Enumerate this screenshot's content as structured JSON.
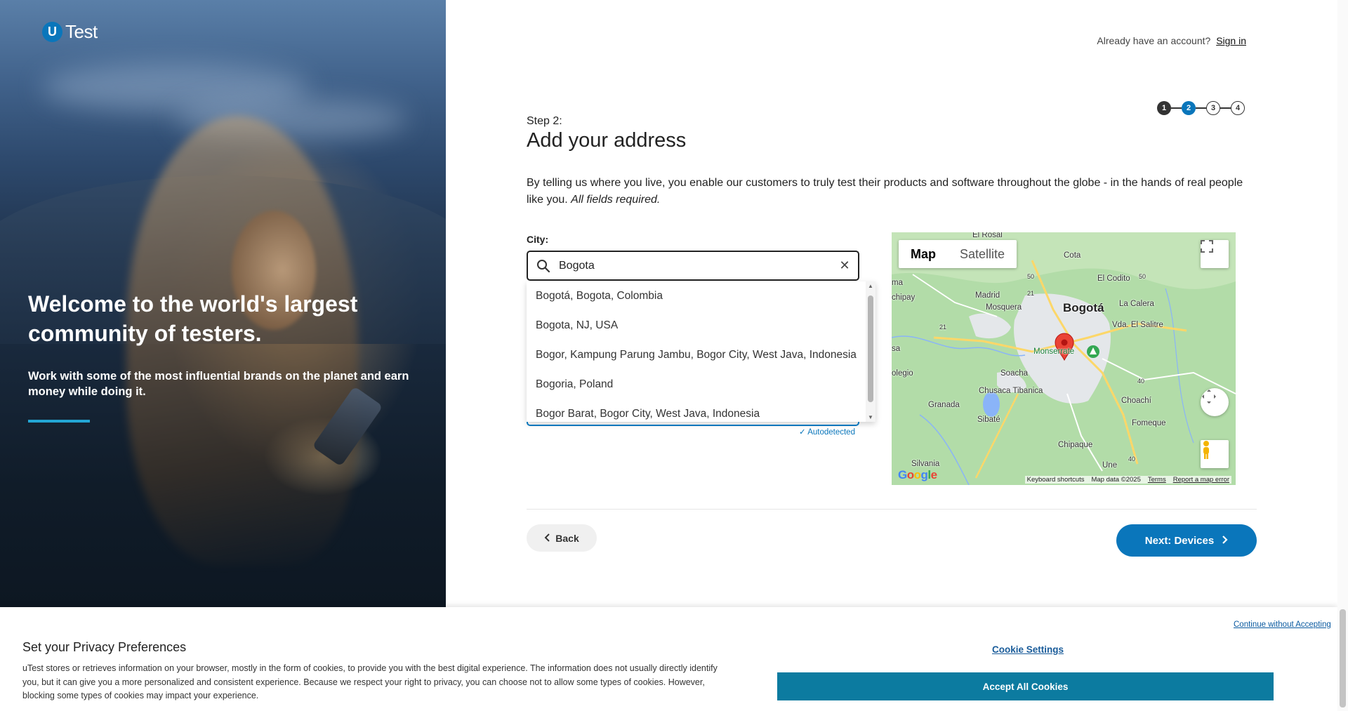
{
  "brand": {
    "logo_letter": "U",
    "logo_word": "Test"
  },
  "hero": {
    "title": "Welcome to the world's largest community of testers.",
    "subtitle": "Work with some of the most influential brands on the planet and earn money while doing it."
  },
  "header": {
    "already_text": "Already have an account?",
    "sign_in": "Sign in"
  },
  "steps": {
    "items": [
      "1",
      "2",
      "3",
      "4"
    ],
    "current": 2
  },
  "form": {
    "step_label": "Step 2:",
    "title": "Add your address",
    "intro": "By telling us where you live, you enable our customers to truly test their products and software throughout the globe - in the hands of real people like you.",
    "intro_emph": "All fields required.",
    "city_label": "City:",
    "city_value": "Bogota",
    "suggestions": [
      "Bogotá, Bogota, Colombia",
      "Bogota, NJ, USA",
      "Bogor, Kampung Parung Jambu, Bogor City, West Java, Indonesia",
      "Bogoria, Poland",
      "Bogor Barat, Bogor City, West Java, Indonesia"
    ],
    "autodetected": "✓ Autodetected"
  },
  "map": {
    "tab_map": "Map",
    "tab_satellite": "Satellite",
    "labels": {
      "el_rosal": "El Rosal",
      "cota": "Cota",
      "el_codito": "El Codito",
      "madrid": "Madrid",
      "mosquera": "Mosquera",
      "bogota": "Bogotá",
      "la_calera": "La Calera",
      "vda_el_salitre": "Vda. El Salitre",
      "chipay": "chipay",
      "ma": "ma",
      "sa": "sa",
      "monserrate": "Monserrate",
      "soacha": "Soacha",
      "olegio": "olegio",
      "chusaca": "Chusaca Tibanica",
      "granada": "Granada",
      "sibate": "Sibaté",
      "choachi": "Choachí",
      "fomeque": "Fomeque",
      "chipaque": "Chipaque",
      "silvania": "Silvania",
      "une": "Une",
      "r50a": "50",
      "r50b": "50",
      "r21a": "21",
      "r21b": "21",
      "r40a": "40",
      "r40b": "40"
    },
    "footer": {
      "shortcuts": "Keyboard shortcuts",
      "data": "Map data ©2025",
      "terms": "Terms",
      "report": "Report a map error"
    },
    "google": "Google",
    "colors": {
      "park": "#a8d8a2",
      "urban": "#e4e7ea",
      "water": "#8ab4f8",
      "road": "#ffffff",
      "highway": "#fcd769",
      "pin": "#ea4335"
    }
  },
  "actions": {
    "back": "Back",
    "next": "Next: Devices"
  },
  "cookie": {
    "title": "Set your Privacy Preferences",
    "body": "uTest stores or retrieves information on your browser, mostly in the form of cookies, to provide you with the best digital experience. The information does not usually directly identify you, but it can give you a more personalized and consistent experience. Because we respect your right to privacy, you can choose not to allow some types of cookies. However, blocking some types of cookies may impact your experience.",
    "continue": "Continue without Accepting",
    "settings": "Cookie Settings",
    "accept": "Accept All Cookies"
  }
}
